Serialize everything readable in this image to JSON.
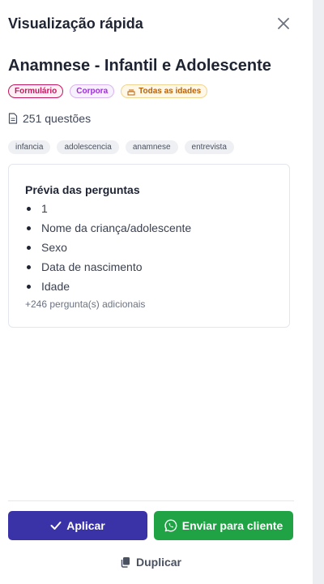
{
  "header": {
    "title": "Visualização rápida",
    "close_icon": "close-icon"
  },
  "template": {
    "title": "Anamnese - Infantil e Adolescente",
    "badges": [
      {
        "label": "Formulário",
        "color": "#c0185f"
      },
      {
        "label": "Corpora",
        "color": "#9c2fd3"
      },
      {
        "label": "Todas as idades",
        "icon": "cake-icon",
        "color": "#b5620a"
      }
    ],
    "question_count": "251 questões",
    "tags": [
      "infancia",
      "adolescencia",
      "anamnese",
      "entrevista"
    ]
  },
  "preview": {
    "title": "Prévia das perguntas",
    "questions": [
      "1",
      "Nome da criança/adolescente",
      "Sexo",
      "Data de nascimento",
      "Idade"
    ],
    "more": "+246 pergunta(s) adicionais"
  },
  "actions": {
    "apply_label": "Aplicar",
    "apply_color": "#3a33a8",
    "send_label": "Enviar para cliente",
    "send_color": "#1fa344",
    "duplicate_label": "Duplicar"
  }
}
